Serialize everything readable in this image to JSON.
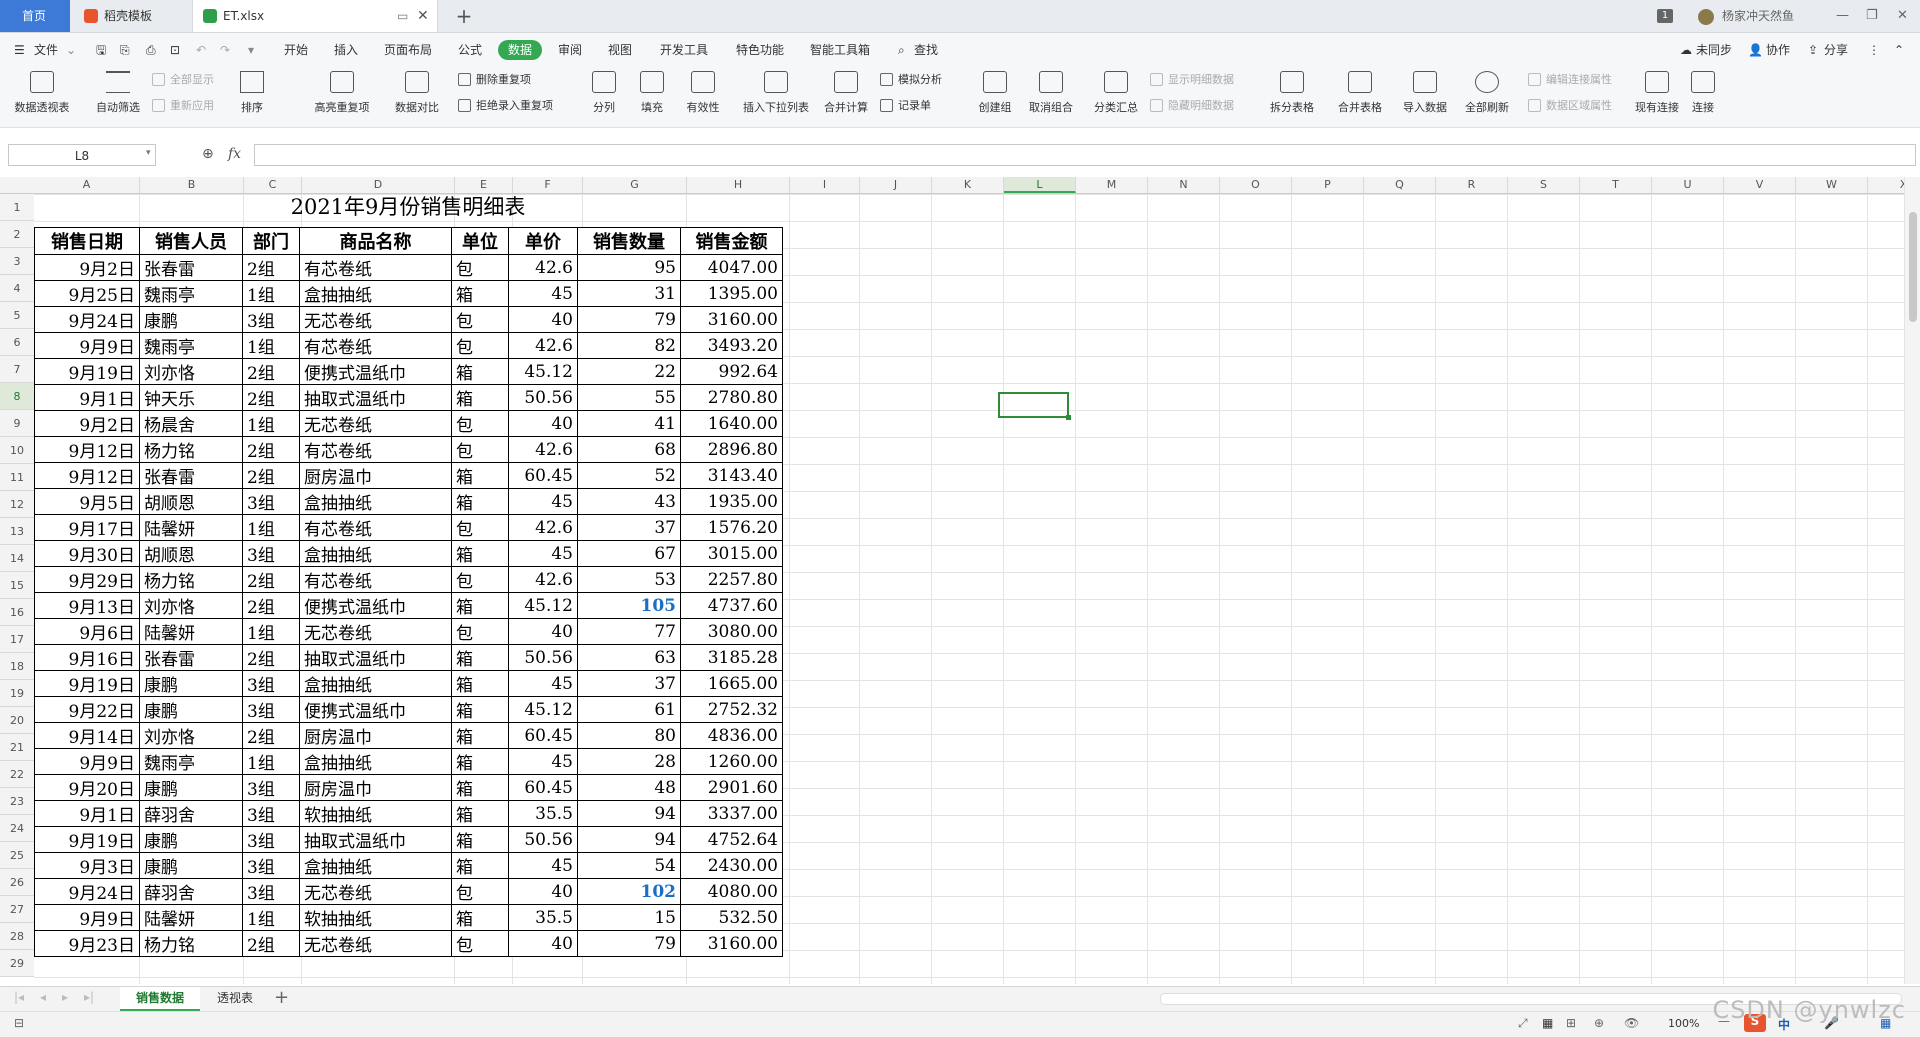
{
  "tabs": {
    "home": "首页",
    "template": "稻壳模板",
    "file": "ET.xlsx"
  },
  "window": {
    "badge": "1",
    "user": "杨家冲天然鱼"
  },
  "menu": {
    "file": "文件",
    "items": [
      "开始",
      "插入",
      "页面布局",
      "公式",
      "数据",
      "审阅",
      "视图",
      "开发工具",
      "特色功能",
      "智能工具箱"
    ],
    "active": "数据",
    "search": "查找",
    "sync": "未同步",
    "collab": "协作",
    "share": "分享"
  },
  "ribbon": {
    "pivot": "数据透视表",
    "autofilter": "自动筛选",
    "show_all": "全部显示",
    "reapply": "重新应用",
    "sort": "排序",
    "highlight_dup": "高亮重复项",
    "delete_dup": "删除重复项",
    "reject_dup": "拒绝录入重复项",
    "compare": "数据对比",
    "split_col": "分列",
    "fill": "填充",
    "validity": "有效性",
    "insert_dropdown": "插入下拉列表",
    "consolidate": "合并计算",
    "what_if": "模拟分析",
    "record": "记录单",
    "create_group": "创建组",
    "ungroup": "取消组合",
    "subtotal": "分类汇总",
    "show_detail": "显示明细数据",
    "hide_detail": "隐藏明细数据",
    "split_table": "拆分表格",
    "merge_table": "合并表格",
    "import": "导入数据",
    "refresh_all": "全部刷新",
    "edit_conn": "编辑连接属性",
    "region_prop": "数据区域属性",
    "existing_conn": "现有连接",
    "connect": "连接"
  },
  "formula_bar": {
    "name_box": "L8",
    "fx": "fx",
    "value": ""
  },
  "columns": [
    "A",
    "B",
    "C",
    "D",
    "E",
    "F",
    "G",
    "H",
    "I",
    "J",
    "K",
    "L",
    "M",
    "N",
    "O",
    "P",
    "Q",
    "R",
    "S",
    "T",
    "U",
    "V",
    "W",
    "X"
  ],
  "selected_column": "L",
  "selected_row": 8,
  "sheet": {
    "title": "2021年9月份销售明细表",
    "headers": [
      "销售日期",
      "销售人员",
      "部门",
      "商品名称",
      "单位",
      "单价",
      "销售数量",
      "销售金额"
    ],
    "rows": [
      [
        "9月2日",
        "张春雷",
        "2组",
        "有芯卷纸",
        "包",
        "42.6",
        "95",
        "4047.00"
      ],
      [
        "9月25日",
        "魏雨亭",
        "1组",
        "盒抽抽纸",
        "箱",
        "45",
        "31",
        "1395.00"
      ],
      [
        "9月24日",
        "康鹏",
        "3组",
        "无芯卷纸",
        "包",
        "40",
        "79",
        "3160.00"
      ],
      [
        "9月9日",
        "魏雨亭",
        "1组",
        "有芯卷纸",
        "包",
        "42.6",
        "82",
        "3493.20"
      ],
      [
        "9月19日",
        "刘亦恪",
        "2组",
        "便携式温纸巾",
        "箱",
        "45.12",
        "22",
        "992.64"
      ],
      [
        "9月1日",
        "钟天乐",
        "2组",
        "抽取式温纸巾",
        "箱",
        "50.56",
        "55",
        "2780.80"
      ],
      [
        "9月2日",
        "杨晨舍",
        "1组",
        "无芯卷纸",
        "包",
        "40",
        "41",
        "1640.00"
      ],
      [
        "9月12日",
        "杨力铭",
        "2组",
        "有芯卷纸",
        "包",
        "42.6",
        "68",
        "2896.80"
      ],
      [
        "9月12日",
        "张春雷",
        "2组",
        "厨房温巾",
        "箱",
        "60.45",
        "52",
        "3143.40"
      ],
      [
        "9月5日",
        "胡顺恩",
        "3组",
        "盒抽抽纸",
        "箱",
        "45",
        "43",
        "1935.00"
      ],
      [
        "9月17日",
        "陆馨妍",
        "1组",
        "有芯卷纸",
        "包",
        "42.6",
        "37",
        "1576.20"
      ],
      [
        "9月30日",
        "胡顺恩",
        "3组",
        "盒抽抽纸",
        "箱",
        "45",
        "67",
        "3015.00"
      ],
      [
        "9月29日",
        "杨力铭",
        "2组",
        "有芯卷纸",
        "包",
        "42.6",
        "53",
        "2257.80"
      ],
      [
        "9月13日",
        "刘亦恪",
        "2组",
        "便携式温纸巾",
        "箱",
        "45.12",
        "105",
        "4737.60"
      ],
      [
        "9月6日",
        "陆馨妍",
        "1组",
        "无芯卷纸",
        "包",
        "40",
        "77",
        "3080.00"
      ],
      [
        "9月16日",
        "张春雷",
        "2组",
        "抽取式温纸巾",
        "箱",
        "50.56",
        "63",
        "3185.28"
      ],
      [
        "9月19日",
        "康鹏",
        "3组",
        "盒抽抽纸",
        "箱",
        "45",
        "37",
        "1665.00"
      ],
      [
        "9月22日",
        "康鹏",
        "3组",
        "便携式温纸巾",
        "箱",
        "45.12",
        "61",
        "2752.32"
      ],
      [
        "9月14日",
        "刘亦恪",
        "2组",
        "厨房温巾",
        "箱",
        "60.45",
        "80",
        "4836.00"
      ],
      [
        "9月9日",
        "魏雨亭",
        "1组",
        "盒抽抽纸",
        "箱",
        "45",
        "28",
        "1260.00"
      ],
      [
        "9月20日",
        "康鹏",
        "3组",
        "厨房温巾",
        "箱",
        "60.45",
        "48",
        "2901.60"
      ],
      [
        "9月1日",
        "薛羽舍",
        "3组",
        "软抽抽纸",
        "箱",
        "35.5",
        "94",
        "3337.00"
      ],
      [
        "9月19日",
        "康鹏",
        "3组",
        "抽取式温纸巾",
        "箱",
        "50.56",
        "94",
        "4752.64"
      ],
      [
        "9月3日",
        "康鹏",
        "3组",
        "盒抽抽纸",
        "箱",
        "45",
        "54",
        "2430.00"
      ],
      [
        "9月24日",
        "薛羽舍",
        "3组",
        "无芯卷纸",
        "包",
        "40",
        "102",
        "4080.00"
      ],
      [
        "9月9日",
        "陆馨妍",
        "1组",
        "软抽抽纸",
        "箱",
        "35.5",
        "15",
        "532.50"
      ],
      [
        "9月23日",
        "杨力铭",
        "2组",
        "无芯卷纸",
        "包",
        "40",
        "79",
        "3160.00"
      ]
    ],
    "highlighted_values": [
      "105",
      "102"
    ]
  },
  "sheet_tabs": [
    "销售数据",
    "透视表"
  ],
  "active_sheet": "销售数据",
  "status": {
    "zoom": "100%",
    "ime": "中",
    "watermark": "CSDN @ynwlzc"
  },
  "colors": {
    "accent": "#34a853",
    "home_tab": "#3d7ad8",
    "highlight_value": "#1a6fc4"
  }
}
